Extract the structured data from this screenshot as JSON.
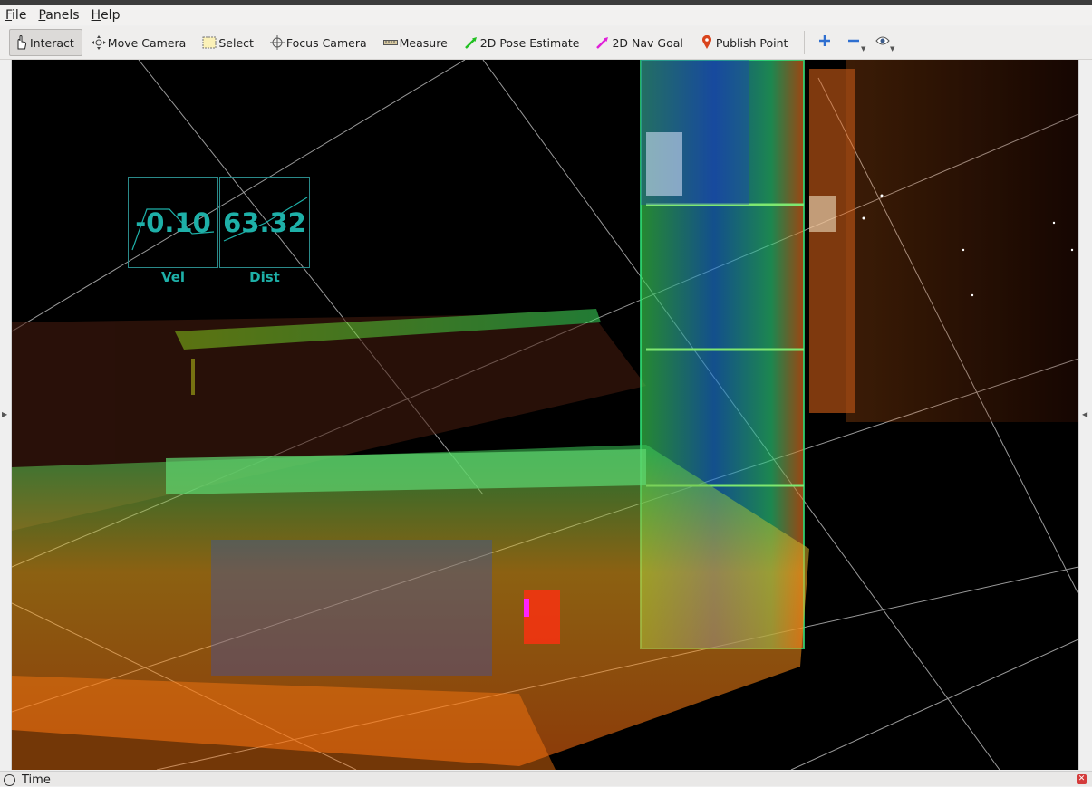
{
  "menubar": {
    "items": [
      {
        "label_first": "F",
        "label_rest": "ile"
      },
      {
        "label_first": "P",
        "label_rest": "anels"
      },
      {
        "label_first": "H",
        "label_rest": "elp"
      }
    ]
  },
  "toolbar": {
    "interact": "Interact",
    "move_camera": "Move Camera",
    "select": "Select",
    "focus_camera": "Focus Camera",
    "measure": "Measure",
    "pose_estimate": "2D Pose Estimate",
    "nav_goal": "2D Nav Goal",
    "publish_point": "Publish Point",
    "icons": [
      "hand-pointer-icon",
      "move-camera-icon",
      "select-box-icon",
      "focus-crosshair-icon",
      "ruler-icon",
      "green-arrow-icon",
      "magenta-arrow-icon",
      "map-pin-icon",
      "plus-icon",
      "minus-icon",
      "eye-icon"
    ]
  },
  "overlay": {
    "vel_value": "-0.10",
    "vel_label": "Vel",
    "dist_value": "63.32",
    "dist_label": "Dist"
  },
  "bottom": {
    "time_label": "Time"
  },
  "colors": {
    "overlay_text": "#1eb0a8",
    "viewport_bg": "#000000",
    "grid": "#9a9a9a"
  }
}
